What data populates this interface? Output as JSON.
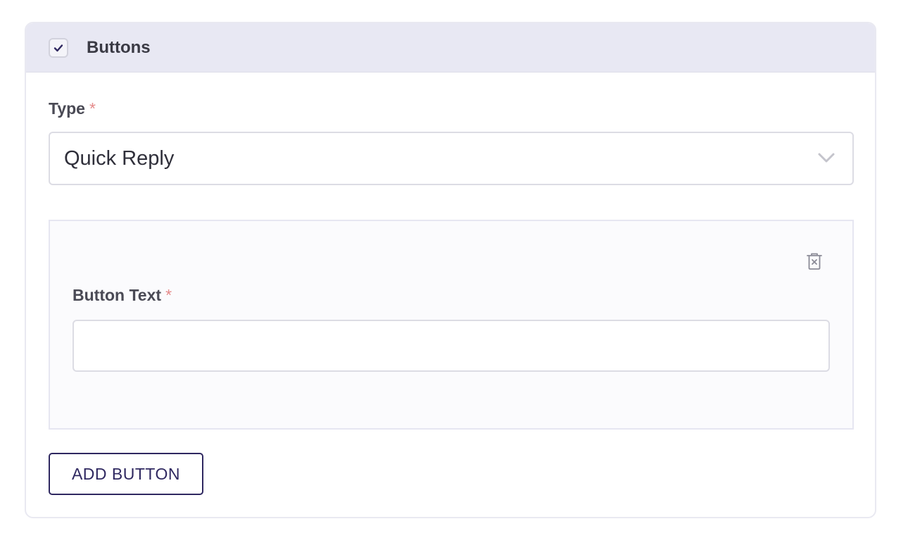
{
  "section": {
    "title": "Buttons",
    "enabled": true
  },
  "type_field": {
    "label": "Type",
    "required_mark": "*",
    "value": "Quick Reply"
  },
  "button_item": {
    "label": "Button Text",
    "required_mark": "*",
    "value": "",
    "placeholder": ""
  },
  "actions": {
    "add_button_label": "ADD BUTTON"
  },
  "icons": {
    "checkbox": "check-icon",
    "select": "chevron-down-icon",
    "delete": "trash-icon"
  },
  "colors": {
    "header_bg": "#e8e8f3",
    "accent": "#2f2860",
    "required": "#e58a8a"
  }
}
